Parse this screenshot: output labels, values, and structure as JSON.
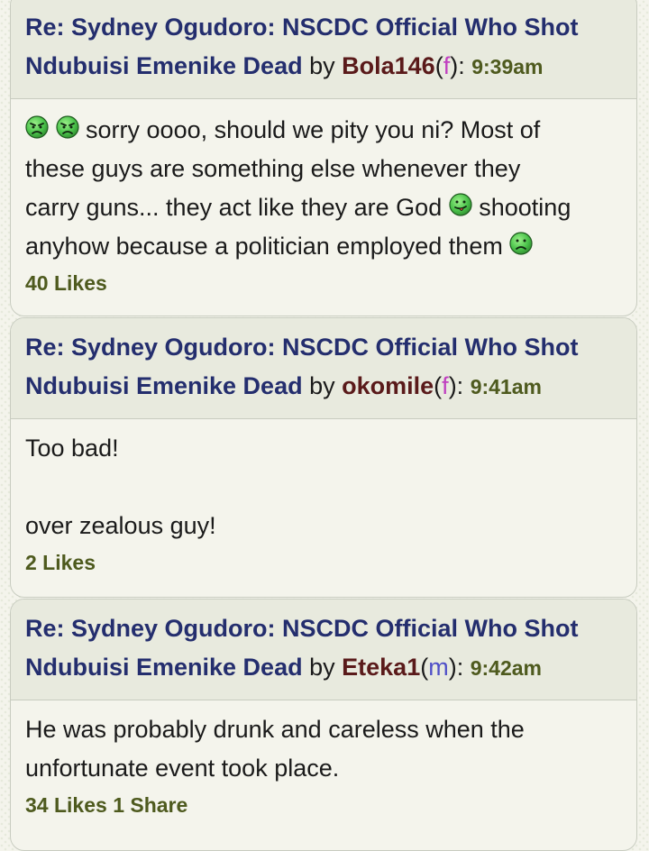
{
  "topic_title_line1": "Re: Sydney Ogudoro: NSCDC Official Who Shot",
  "topic_title_line2": "Ndubuisi Emenike Dead",
  "by_label": "by",
  "posts": [
    {
      "username": "Bola146",
      "gender": "f",
      "time": "9:39am",
      "body": {
        "seg1": "sorry oooo, should we pity you ni? Most of",
        "seg2": "these guys are something else whenever they",
        "seg3": "carry guns... they act like they are God",
        "seg4": "shooting",
        "seg5": "anyhow because a politician employed them"
      },
      "likes": "40 Likes"
    },
    {
      "username": "okomile",
      "gender": "f",
      "time": "9:41am",
      "body": {
        "line1": "Too bad!",
        "line2": "over zealous guy!"
      },
      "likes": "2 Likes"
    },
    {
      "username": "Eteka1",
      "gender": "m",
      "time": "9:42am",
      "body": {
        "line1": "He was probably drunk and careless when the",
        "line2": "unfortunate event took place."
      },
      "likes": "34 Likes",
      "shares": "1 Share"
    }
  ],
  "emoticons": {
    "angry": "angry-face-icon",
    "tongue": "tongue-face-icon",
    "sad": "sad-face-icon"
  },
  "colors": {
    "topic_link": "#242e6e",
    "username": "#5a1a1a",
    "time_and_likes": "#4e5a1e",
    "gender_f": "#c040c0",
    "gender_m": "#5050c8",
    "emoticon_green": "#4cc44c"
  }
}
